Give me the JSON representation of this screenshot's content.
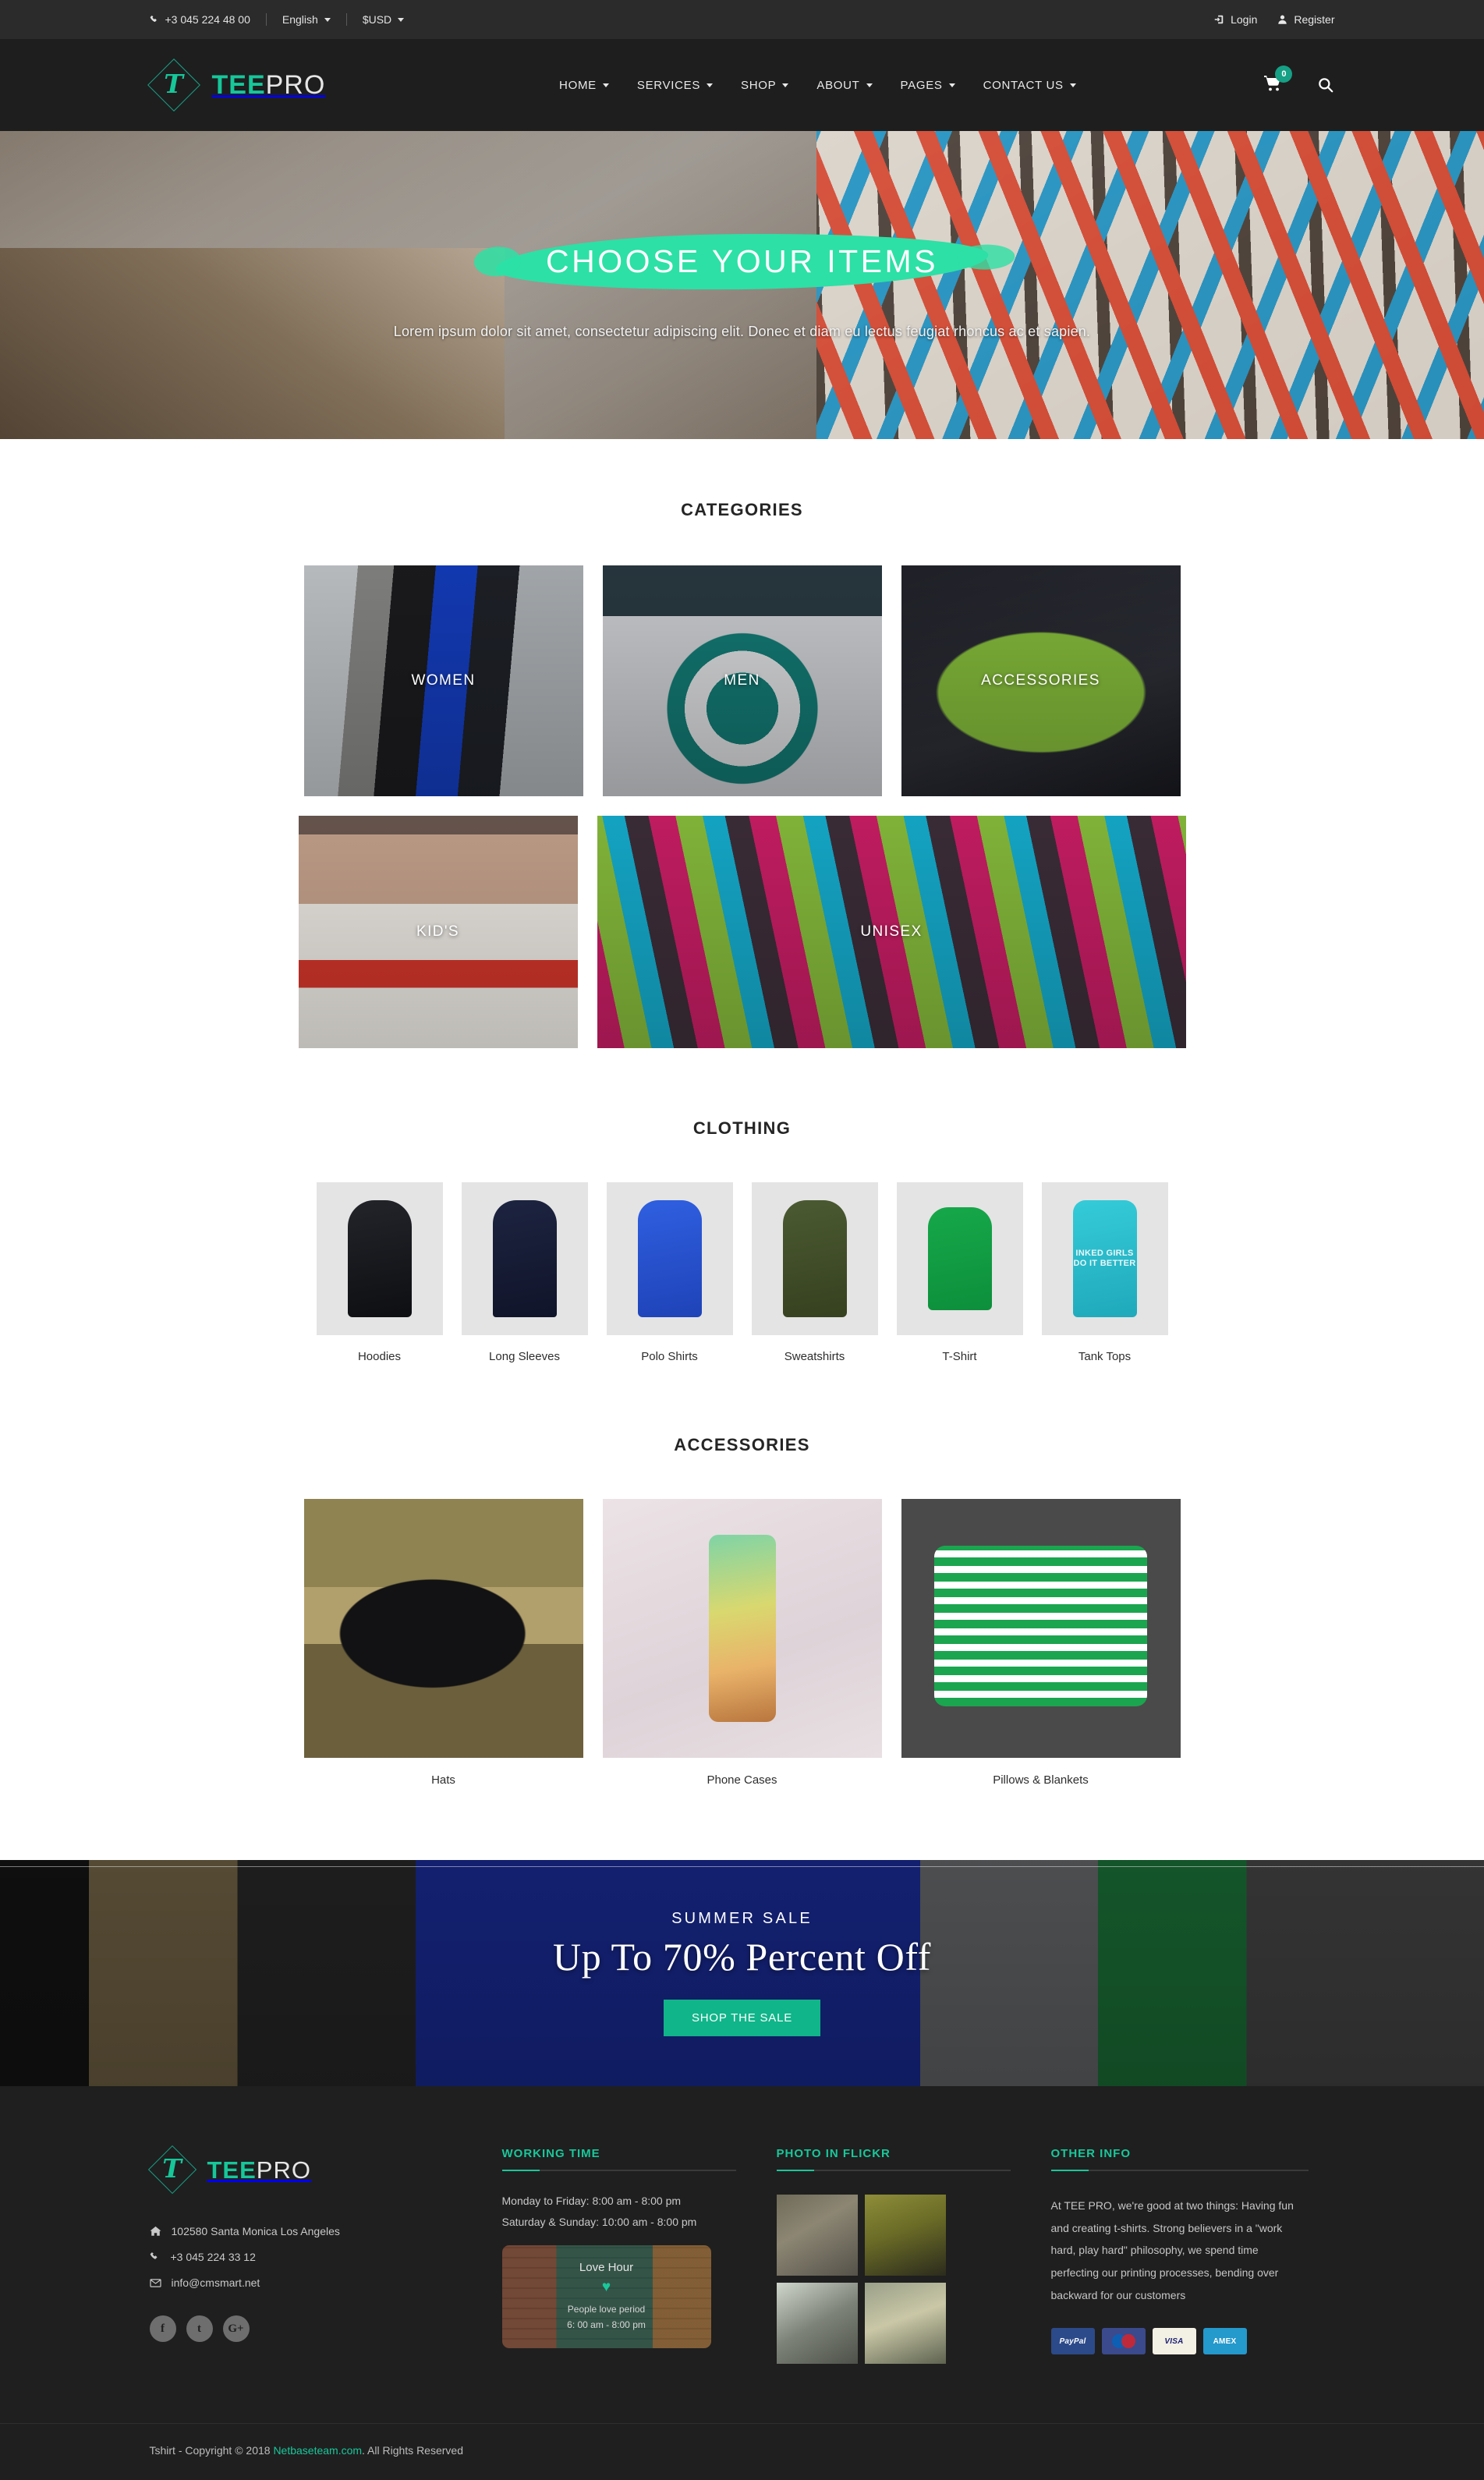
{
  "topbar": {
    "phone": "+3 045 224 48 00",
    "language": "English",
    "currency": "$USD",
    "login": "Login",
    "register": "Register"
  },
  "header": {
    "logo_primary": "TEE",
    "logo_secondary": "PRO",
    "logo_glyph": "T",
    "nav": [
      {
        "label": "HOME"
      },
      {
        "label": "SERVICES"
      },
      {
        "label": "SHOP"
      },
      {
        "label": "ABOUT"
      },
      {
        "label": "PAGES"
      },
      {
        "label": "CONTACT US"
      }
    ],
    "cart_count": "0"
  },
  "hero": {
    "title": "CHOOSE YOUR ITEMS",
    "subtitle": "Lorem ipsum dolor sit amet, consectetur adipiscing elit. Donec et diam eu lectus feugiat rhoncus ac et sapien."
  },
  "categories": {
    "title": "CATEGORIES",
    "row1": [
      {
        "label": "WOMEN"
      },
      {
        "label": "MEN"
      },
      {
        "label": "ACCESSORIES"
      }
    ],
    "row2": [
      {
        "label": "KID'S"
      },
      {
        "label": "UNISEX"
      }
    ]
  },
  "clothing": {
    "title": "CLOTHING",
    "items": [
      {
        "label": "Hoodies"
      },
      {
        "label": "Long Sleeves"
      },
      {
        "label": "Polo Shirts"
      },
      {
        "label": "Sweatshirts"
      },
      {
        "label": "T-Shirt"
      },
      {
        "label": "Tank Tops"
      }
    ],
    "tank_print": "INKED GIRLS DO IT BETTER"
  },
  "accessories": {
    "title": "ACCESSORIES",
    "items": [
      {
        "label": "Hats"
      },
      {
        "label": "Phone Cases"
      },
      {
        "label": "Pillows & Blankets"
      }
    ]
  },
  "sale": {
    "kicker": "SUMMER  SALE",
    "headline": "Up To 70% Percent Off",
    "button": "SHOP THE SALE"
  },
  "footer": {
    "logo_primary": "TEE",
    "logo_secondary": "PRO",
    "logo_glyph": "T",
    "address": "102580 Santa Monica Los Angeles",
    "phone": "+3 045 224 33 12",
    "email": "info@cmsmart.net",
    "socials": [
      {
        "name": "facebook",
        "glyph": "f"
      },
      {
        "name": "twitter",
        "glyph": "t"
      },
      {
        "name": "google-plus",
        "glyph": "G+"
      }
    ],
    "working": {
      "heading": "WORKING TIME",
      "line1": "Monday to Friday:  8:00 am - 8:00 pm",
      "line2": "Saturday & Sunday:  10:00 am - 8:00 pm",
      "card_title": "Love Hour",
      "card_heart": "♥",
      "card_line1": "People love period",
      "card_line2": "6: 00 am - 8:00 pm"
    },
    "flickr": {
      "heading": "PHOTO IN FLICKR"
    },
    "other": {
      "heading": "OTHER INFO",
      "text": "At TEE PRO, we're good at two things: Having fun and creating t-shirts. Strong believers in a \"work hard, play hard\" philosophy, we spend time perfecting our printing processes, bending over backward for our customers",
      "payments": [
        {
          "label": "PayPal"
        },
        {
          "label": "Maestro"
        },
        {
          "label": "VISA"
        },
        {
          "label": "AMEX"
        }
      ]
    },
    "copyright_pre": "Tshirt - Copyright © 2018 ",
    "copyright_link": "Netbaseteam.com",
    "copyright_post": ". All Rights Reserved"
  }
}
